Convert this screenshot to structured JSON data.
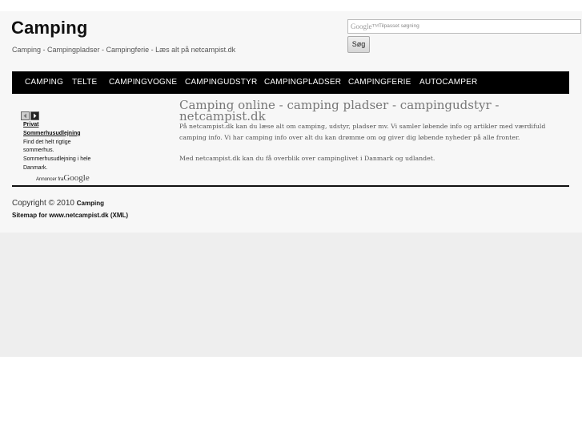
{
  "header": {
    "title": "Camping",
    "tagline": "Camping - Campingpladser - Campingferie - Læs alt på netcampist.dk"
  },
  "search": {
    "brand": "Google™",
    "hint": "Tilpasset søgning",
    "button_label": "Søg"
  },
  "nav": {
    "items": [
      {
        "label": "CAMPING"
      },
      {
        "label": "TELTE"
      },
      {
        "label": "CAMPINGVOGNE"
      },
      {
        "label": "CAMPINGUDSTYR"
      },
      {
        "label": "CAMPINGPLADSER"
      },
      {
        "label": "CAMPINGFERIE"
      },
      {
        "label": "AUTOCAMPER"
      }
    ]
  },
  "ad": {
    "title": "Privat Sommerhusudlejning",
    "text1": "Find det helt rigtige sommerhus.",
    "text2": "Sommerhusudlejning i hele Danmark.",
    "by_label": "Annoncer fra",
    "by_brand": "Google"
  },
  "main": {
    "heading": "Camping online - camping pladser - campingudstyr - netcampist.dk",
    "paragraph1": "På netcampist.dk kan du læse alt om camping, udstyr, pladser mv. Vi samler løbende info og artikler med værdifuld camping info. Vi har camping info over alt du kan drømme om og giver dig løbende nyheder på alle fronter.",
    "paragraph2": "Med netcampist.dk kan du få overblik over campinglivet i Danmark og udlandet."
  },
  "footer": {
    "copyright_prefix": "Copyright © 2010",
    "copyright_name": "Camping",
    "sitemap_label": "Sitemap for www.netcampist.dk",
    "sitemap_link": "(XML)"
  }
}
